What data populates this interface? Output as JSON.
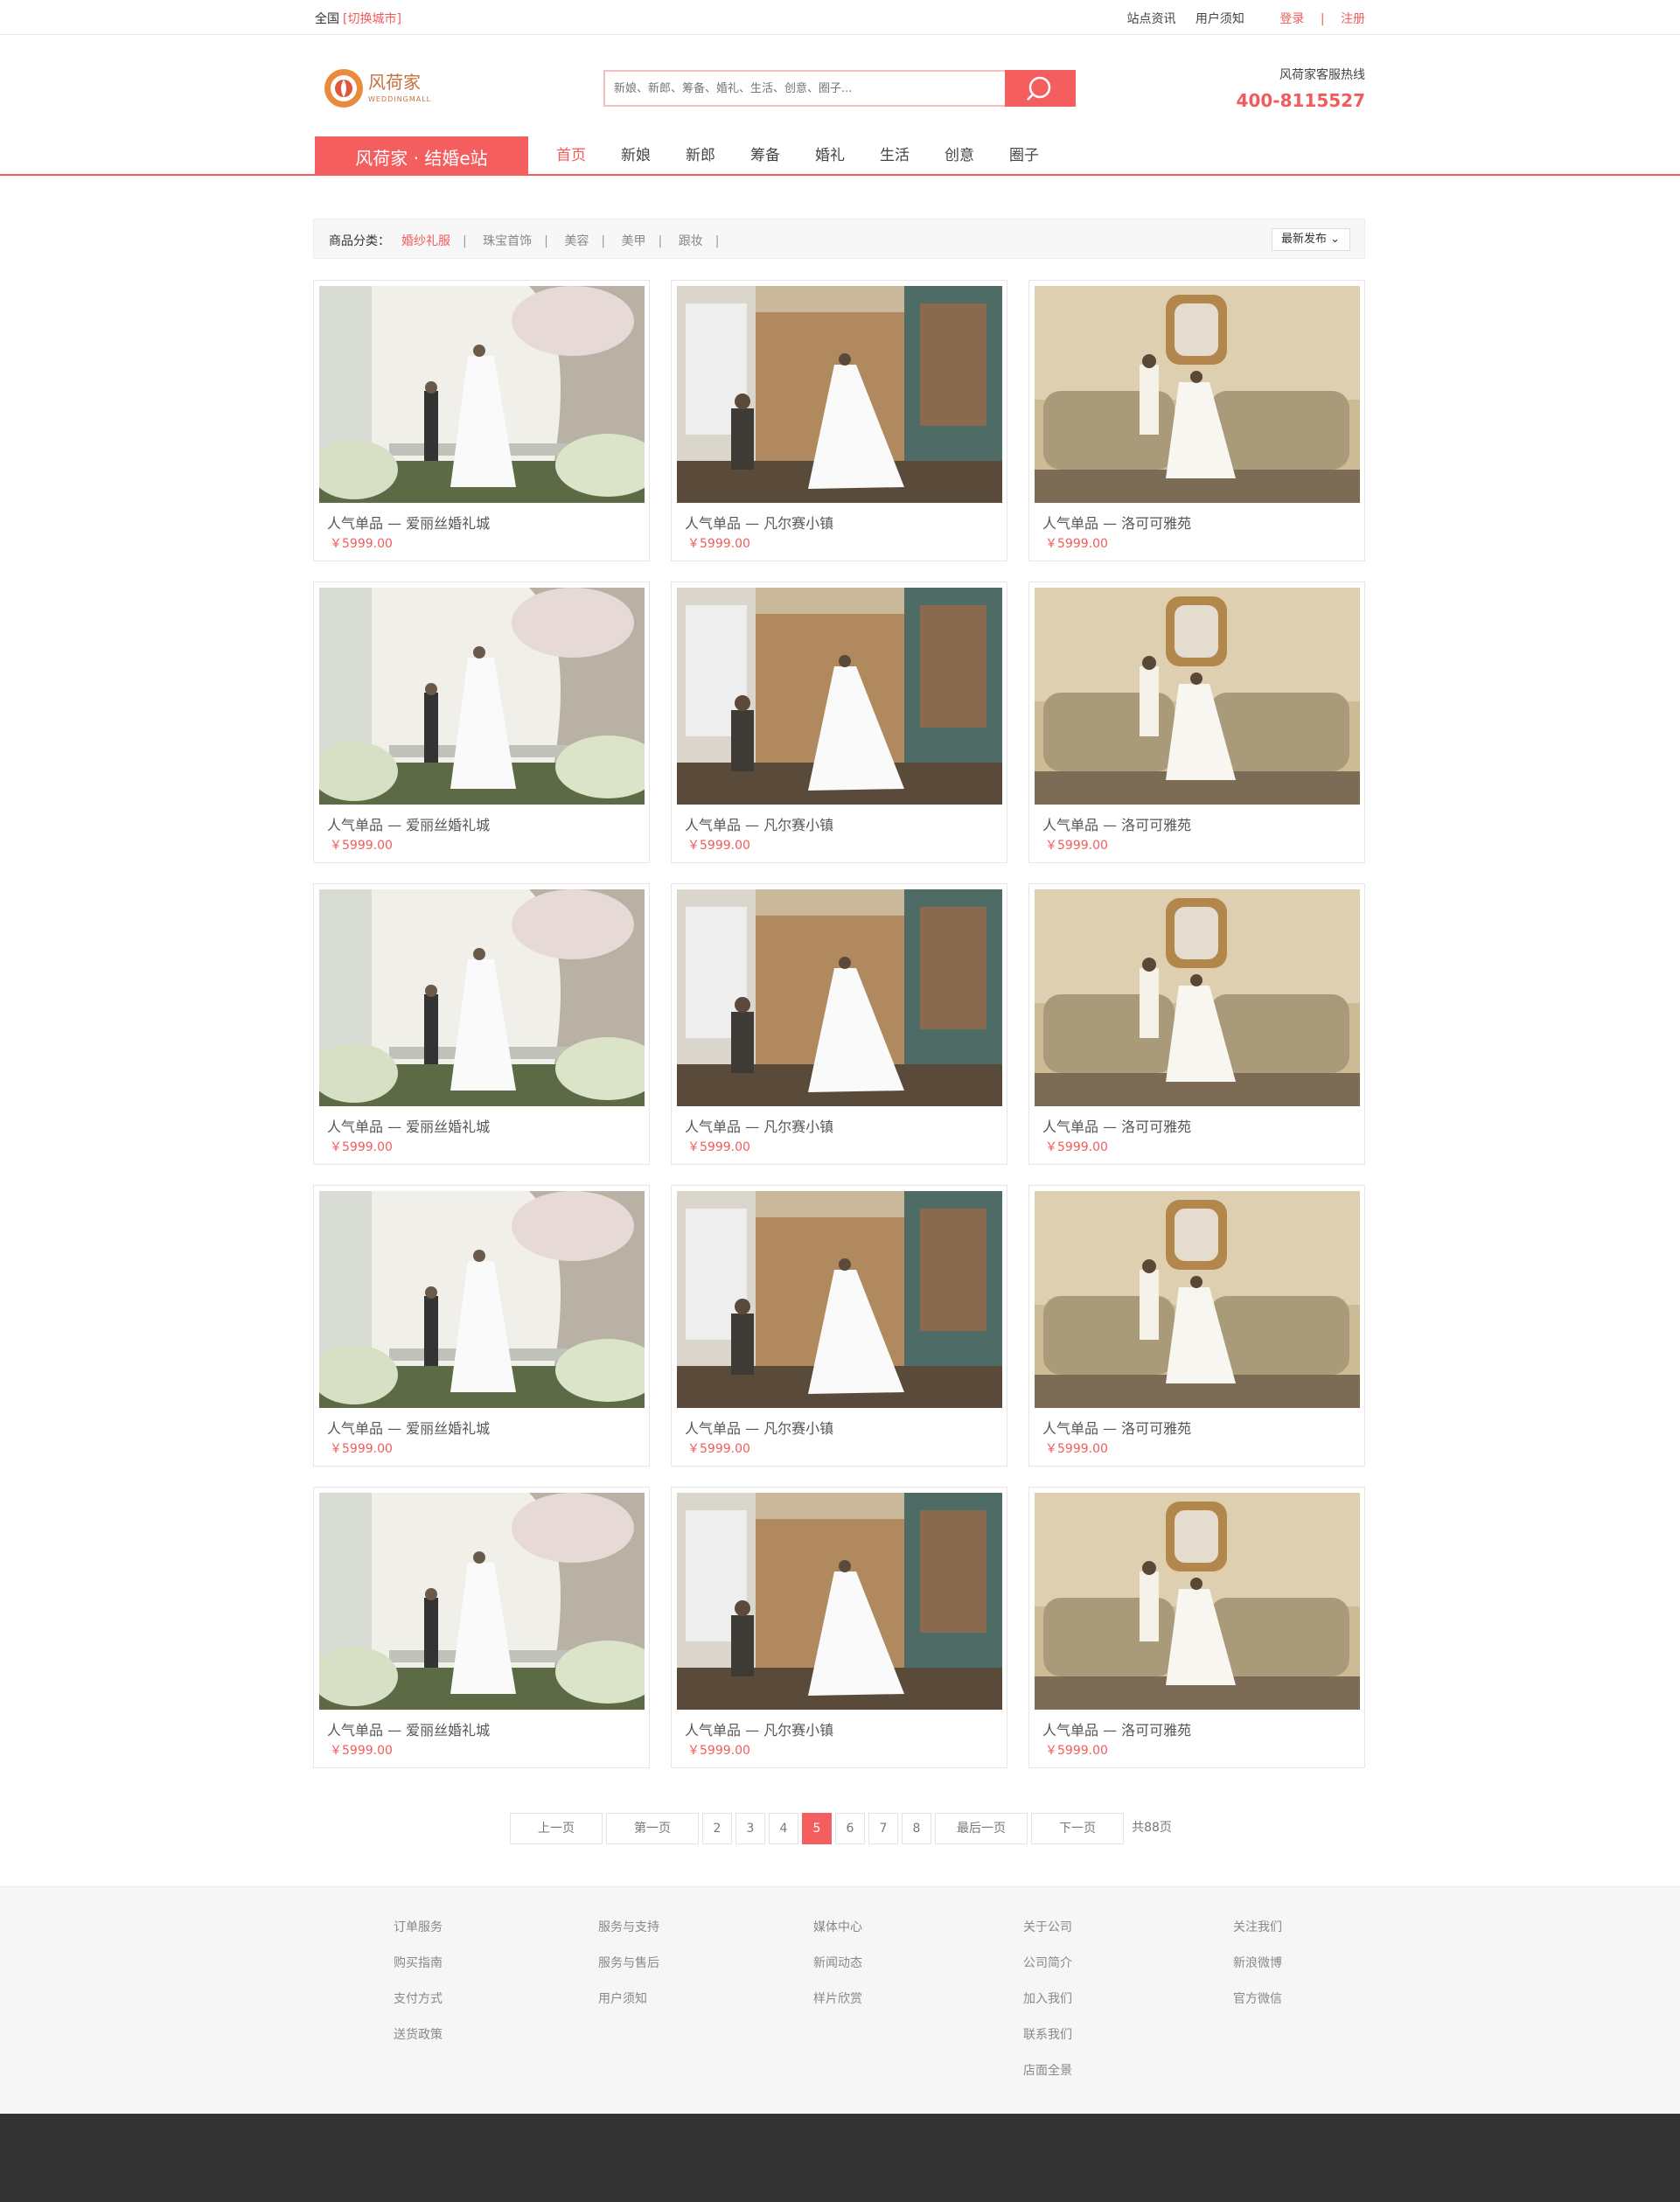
{
  "topbar": {
    "region": "全国",
    "switch_city": "[切换城市]",
    "news": "站点资讯",
    "notice": "用户须知",
    "login": "登录",
    "sep": "|",
    "register": "注册"
  },
  "header": {
    "logo_text": "风荷家",
    "logo_sub": "WEDDINGMALL",
    "search_placeholder": "新娘、新郎、筹备、婚礼、生活、创意、圈子...",
    "hotline_label": "风荷家客服热线",
    "hotline_number": "400-8115527"
  },
  "nav": {
    "brand": "风荷家 · 结婚e站",
    "items": [
      "首页",
      "新娘",
      "新郎",
      "筹备",
      "婚礼",
      "生活",
      "创意",
      "圈子"
    ]
  },
  "filter": {
    "label": "商品分类：",
    "categories": [
      "婚纱礼服",
      "珠宝首饰",
      "美容",
      "美甲",
      "跟妆"
    ],
    "sort": "最新发布"
  },
  "products": [
    {
      "title": "人气单品 — 爱丽丝婚礼城",
      "price": "￥5999.00"
    },
    {
      "title": "人气单品 — 凡尔赛小镇",
      "price": "￥5999.00"
    },
    {
      "title": "人气单品 — 洛可可雅苑",
      "price": "￥5999.00"
    },
    {
      "title": "人气单品 — 爱丽丝婚礼城",
      "price": "￥5999.00"
    },
    {
      "title": "人气单品 — 凡尔赛小镇",
      "price": "￥5999.00"
    },
    {
      "title": "人气单品 — 洛可可雅苑",
      "price": "￥5999.00"
    },
    {
      "title": "人气单品 — 爱丽丝婚礼城",
      "price": "￥5999.00"
    },
    {
      "title": "人气单品 — 凡尔赛小镇",
      "price": "￥5999.00"
    },
    {
      "title": "人气单品 — 洛可可雅苑",
      "price": "￥5999.00"
    },
    {
      "title": "人气单品 — 爱丽丝婚礼城",
      "price": "￥5999.00"
    },
    {
      "title": "人气单品 — 凡尔赛小镇",
      "price": "￥5999.00"
    },
    {
      "title": "人气单品 — 洛可可雅苑",
      "price": "￥5999.00"
    },
    {
      "title": "人气单品 — 爱丽丝婚礼城",
      "price": "￥5999.00"
    },
    {
      "title": "人气单品 — 凡尔赛小镇",
      "price": "￥5999.00"
    },
    {
      "title": "人气单品 — 洛可可雅苑",
      "price": "￥5999.00"
    }
  ],
  "pager": {
    "prev": "上一页",
    "first": "第一页",
    "pages": [
      "2",
      "3",
      "4",
      "5",
      "6",
      "7",
      "8"
    ],
    "current": "5",
    "last": "最后一页",
    "next": "下一页",
    "total": "共88页"
  },
  "footer": {
    "columns": [
      [
        "订单服务",
        "购买指南",
        "支付方式",
        "送货政策"
      ],
      [
        "服务与支持",
        "服务与售后",
        "用户须知"
      ],
      [
        "媒体中心",
        "新闻动态",
        "样片欣赏"
      ],
      [
        "关于公司",
        "公司简介",
        "加入我们",
        "联系我们",
        "店面全景"
      ],
      [
        "关注我们",
        "新浪微博",
        "官方微信"
      ]
    ]
  },
  "colors": {
    "accent": "#f55e5e",
    "footer_dark": "#333333"
  }
}
